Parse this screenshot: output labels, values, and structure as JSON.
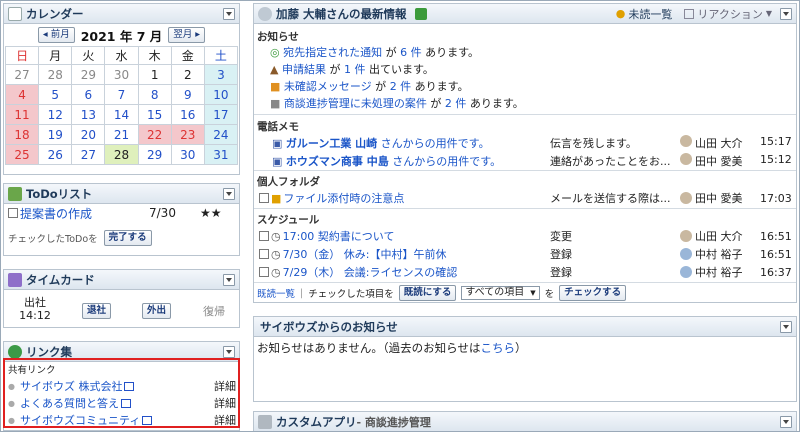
{
  "calendar": {
    "title": "カレンダー",
    "prev": "前月",
    "next": "翌月",
    "year_month": "2021 年 7 月",
    "weekdays": [
      "日",
      "月",
      "火",
      "水",
      "木",
      "金",
      "土"
    ],
    "weeks": [
      [
        "27",
        "28",
        "29",
        "30",
        "1",
        "2",
        "3"
      ],
      [
        "4",
        "5",
        "6",
        "7",
        "8",
        "9",
        "10"
      ],
      [
        "11",
        "12",
        "13",
        "14",
        "15",
        "16",
        "17"
      ],
      [
        "18",
        "19",
        "20",
        "21",
        "22",
        "23",
        "24"
      ],
      [
        "25",
        "26",
        "27",
        "28",
        "29",
        "30",
        "31"
      ]
    ]
  },
  "todo": {
    "title": "ToDoリスト",
    "item": "提案書の作成",
    "date": "7/30",
    "stars": "★★",
    "hint": "チェックしたToDoを",
    "done_btn": "完了する"
  },
  "timecard": {
    "title": "タイムカード",
    "in_label": "出社",
    "in_time": "14:12",
    "out_btn": "退社",
    "away_btn": "外出",
    "return_label": "復帰"
  },
  "links": {
    "title": "リンク集",
    "section": "共有リンク",
    "items": [
      {
        "label": "サイボウズ 株式会社",
        "detail": "詳細"
      },
      {
        "label": "よくある質問と答え",
        "detail": "詳細"
      },
      {
        "label": "サイボウズコミュニティ",
        "detail": "詳細"
      }
    ]
  },
  "info": {
    "title": "加藤 大輔さんの最新情報",
    "unread_btn": "未読一覧",
    "reaction_btn": "リアクション",
    "notice_head": "お知らせ",
    "notices": [
      {
        "pre": "宛先指定された通知",
        "mid": " が ",
        "num": "6 件",
        "post": " あります。"
      },
      {
        "pre": "申請結果",
        "mid": " が ",
        "num": "1 件",
        "post": " 出ています。"
      },
      {
        "pre": "未確認メッセージ",
        "mid": " が ",
        "num": "2 件",
        "post": " あります。"
      },
      {
        "pre": "商談進捗管理に未処理の案件",
        "mid": " が ",
        "num": "2 件",
        "post": " あります。"
      }
    ],
    "memo_head": "電話メモ",
    "memos": [
      {
        "company": "ガルーン工業 山崎",
        "text": " さんからの用件です。",
        "note": "伝言を残します。",
        "user": "山田 大介",
        "time": "15:17"
      },
      {
        "company": "ホウズマン商事 中島",
        "text": " さんからの用件です。",
        "note": "連絡があったことをお...",
        "user": "田中 愛美",
        "time": "15:12"
      }
    ],
    "folder_head": "個人フォルダ",
    "folder": {
      "label": "ファイル添付時の注意点",
      "note": "メールを送信する際は...",
      "user": "田中 愛美",
      "time": "17:03"
    },
    "sched_head": "スケジュール",
    "schedules": [
      {
        "label": "17:00 契約書について",
        "action": "変更",
        "user": "山田 大介",
        "time": "16:51"
      },
      {
        "label": "7/30（金） 休み:【中村】午前休",
        "action": "登録",
        "user": "中村 裕子",
        "time": "16:51"
      },
      {
        "label": "7/29（木） 会議:ライセンスの確認",
        "action": "登録",
        "user": "中村 裕子",
        "time": "16:37"
      }
    ],
    "footer": {
      "read_list": "既読一覧",
      "checked": "チェックした項目を",
      "mark_read": "既読にする",
      "select_value": "すべての項目",
      "wo": "を",
      "check_btn": "チェックする"
    }
  },
  "notice_portlet": {
    "title": "サイボウズからのお知らせ",
    "text": "お知らせはありません。（過去のお知らせは",
    "link": "こちら",
    "close": "）"
  },
  "custom_app": {
    "title": "カスタムアプリ",
    "subtitle": " - 商談進捗管理"
  }
}
